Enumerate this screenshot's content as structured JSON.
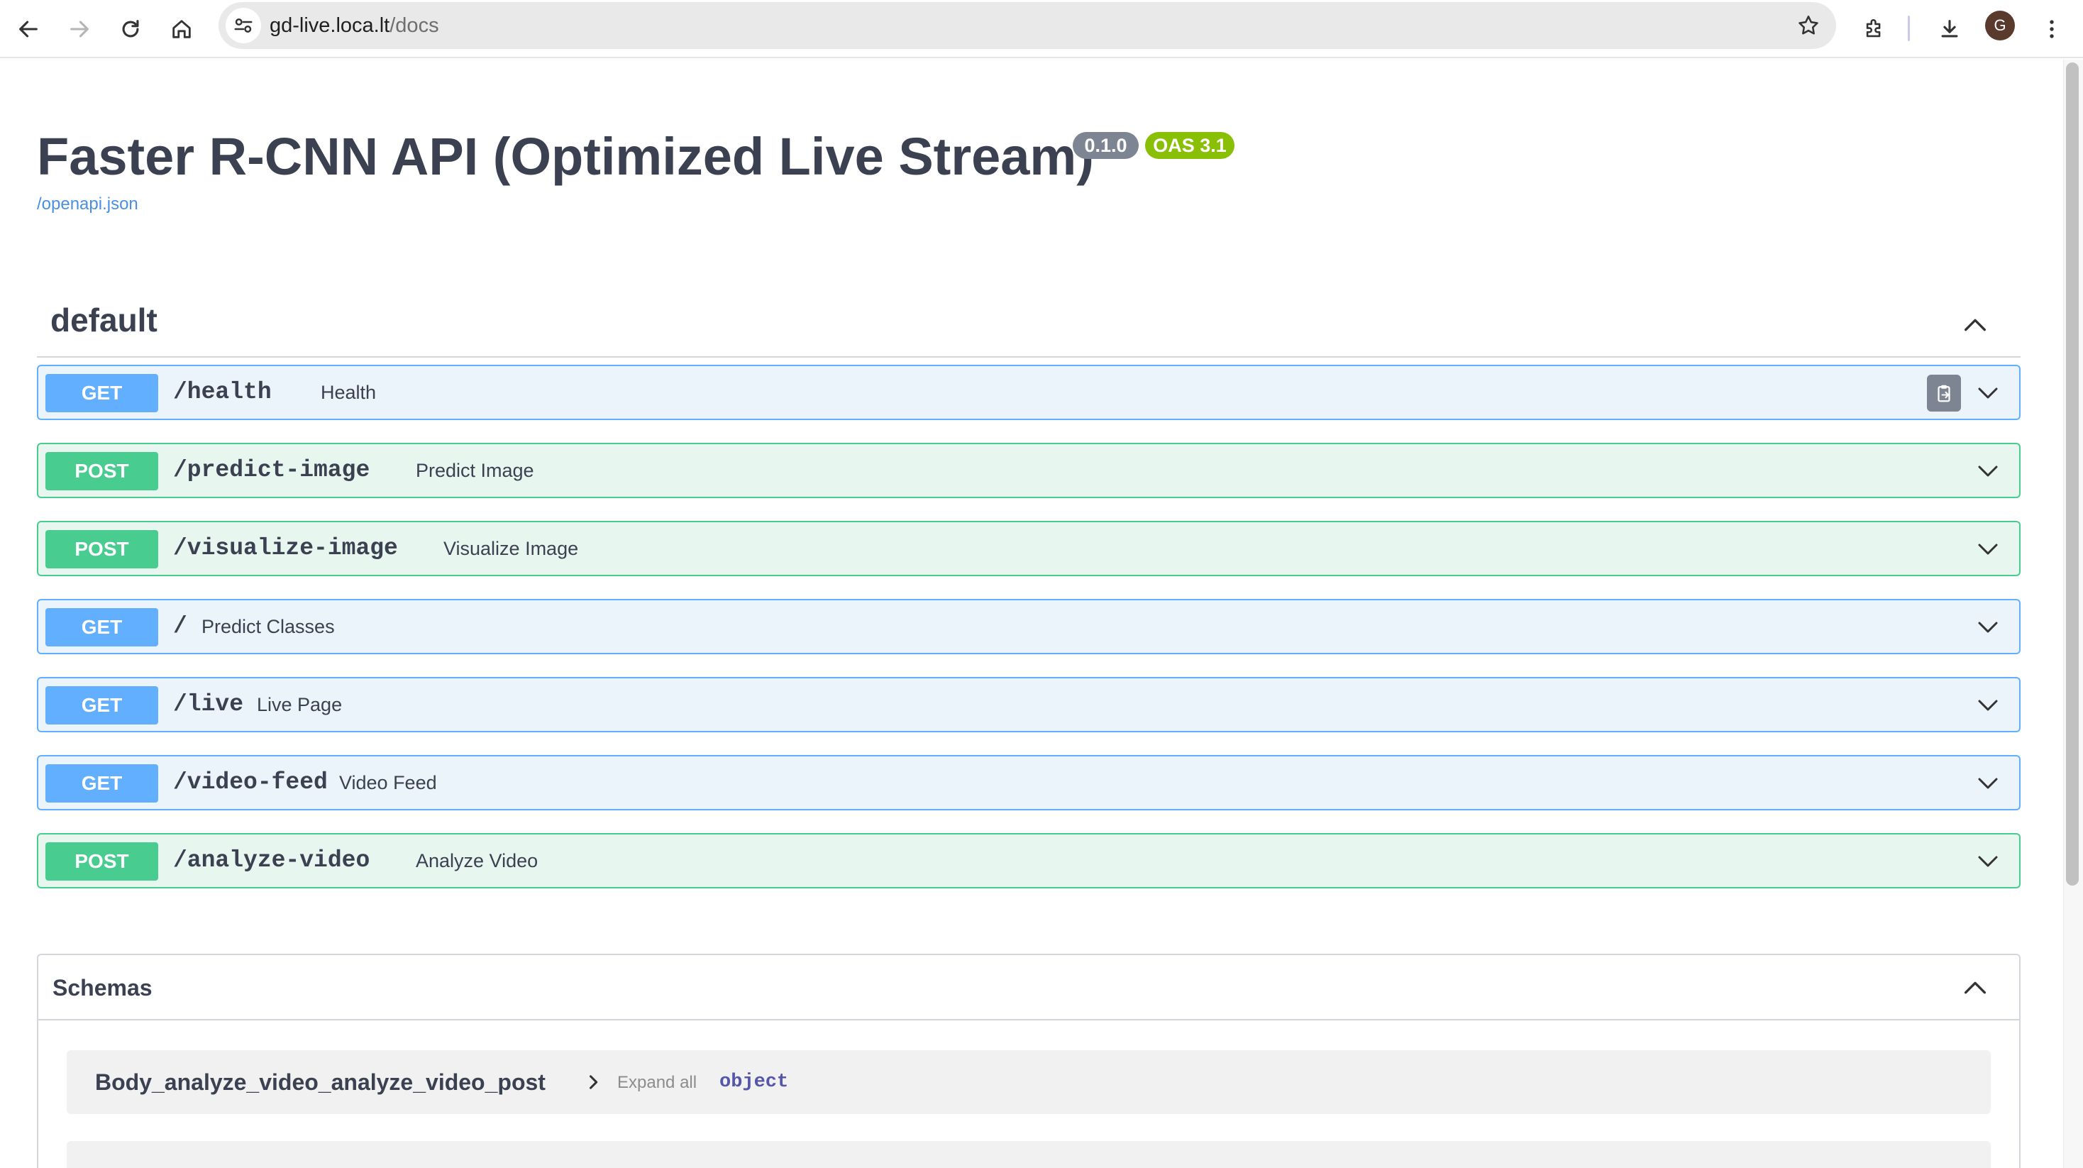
{
  "browser": {
    "url_host": "gd-live.loca.lt",
    "url_path": "/docs",
    "profile_initial": "G"
  },
  "api": {
    "title": "Faster R-CNN API (Optimized Live Stream)",
    "version": "0.1.0",
    "oas": "OAS 3.1",
    "spec_link": "/openapi.json"
  },
  "tag": {
    "name": "default"
  },
  "operations": [
    {
      "method": "GET",
      "path": "/health",
      "summary": "Health"
    },
    {
      "method": "POST",
      "path": "/predict-image",
      "summary": "Predict Image"
    },
    {
      "method": "POST",
      "path": "/visualize-image",
      "summary": "Visualize Image"
    },
    {
      "method": "GET",
      "path": "/",
      "summary": "Predict Classes"
    },
    {
      "method": "GET",
      "path": "/live",
      "summary": "Live Page"
    },
    {
      "method": "GET",
      "path": "/video-feed",
      "summary": "Video Feed"
    },
    {
      "method": "POST",
      "path": "/analyze-video",
      "summary": "Analyze Video"
    }
  ],
  "schemas": {
    "title": "Schemas",
    "models": [
      {
        "name": "Body_analyze_video_analyze_video_post",
        "expand_label": "Expand all",
        "type": "object"
      }
    ]
  },
  "colors": {
    "get": "#61affe",
    "post": "#49cc90",
    "get_bg": "#ebf3fb",
    "post_bg": "#e8f6f0",
    "oas_badge": "#89bf04",
    "version_badge": "#7d8492"
  },
  "icons": [
    "back-icon",
    "forward-icon",
    "reload-icon",
    "home-icon",
    "site-settings-icon",
    "bookmark-star-icon",
    "extensions-icon",
    "download-icon",
    "menu-kebab-icon",
    "copy-icon",
    "chevron-up-icon",
    "chevron-down-icon",
    "chevron-right-icon"
  ]
}
